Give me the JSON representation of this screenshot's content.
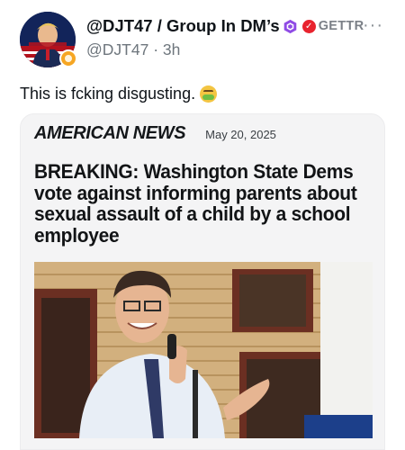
{
  "post": {
    "display_name": "@DJT47 / Group In DM’s",
    "platform_badge": "GETTR",
    "handle": "@DJT47",
    "separator": "·",
    "time_ago": "3h",
    "more_label": "···",
    "body_text": "This is fcking disgusting.",
    "emoji_icon": "nauseated-face-emoji",
    "avatar_icon": "profile-avatar"
  },
  "card": {
    "source": "AMERICAN NEWS",
    "date": "May 20, 2025",
    "headline": "BREAKING: Washington State Dems vote against informing parents about sexual assault of a child by a school employee",
    "image_icon": "man-speaking-at-microphone-photo"
  },
  "colors": {
    "verified": "#8f4be5",
    "gettr": "#e8232e",
    "muted": "#6e767d",
    "card_bg": "#f4f4f5"
  }
}
